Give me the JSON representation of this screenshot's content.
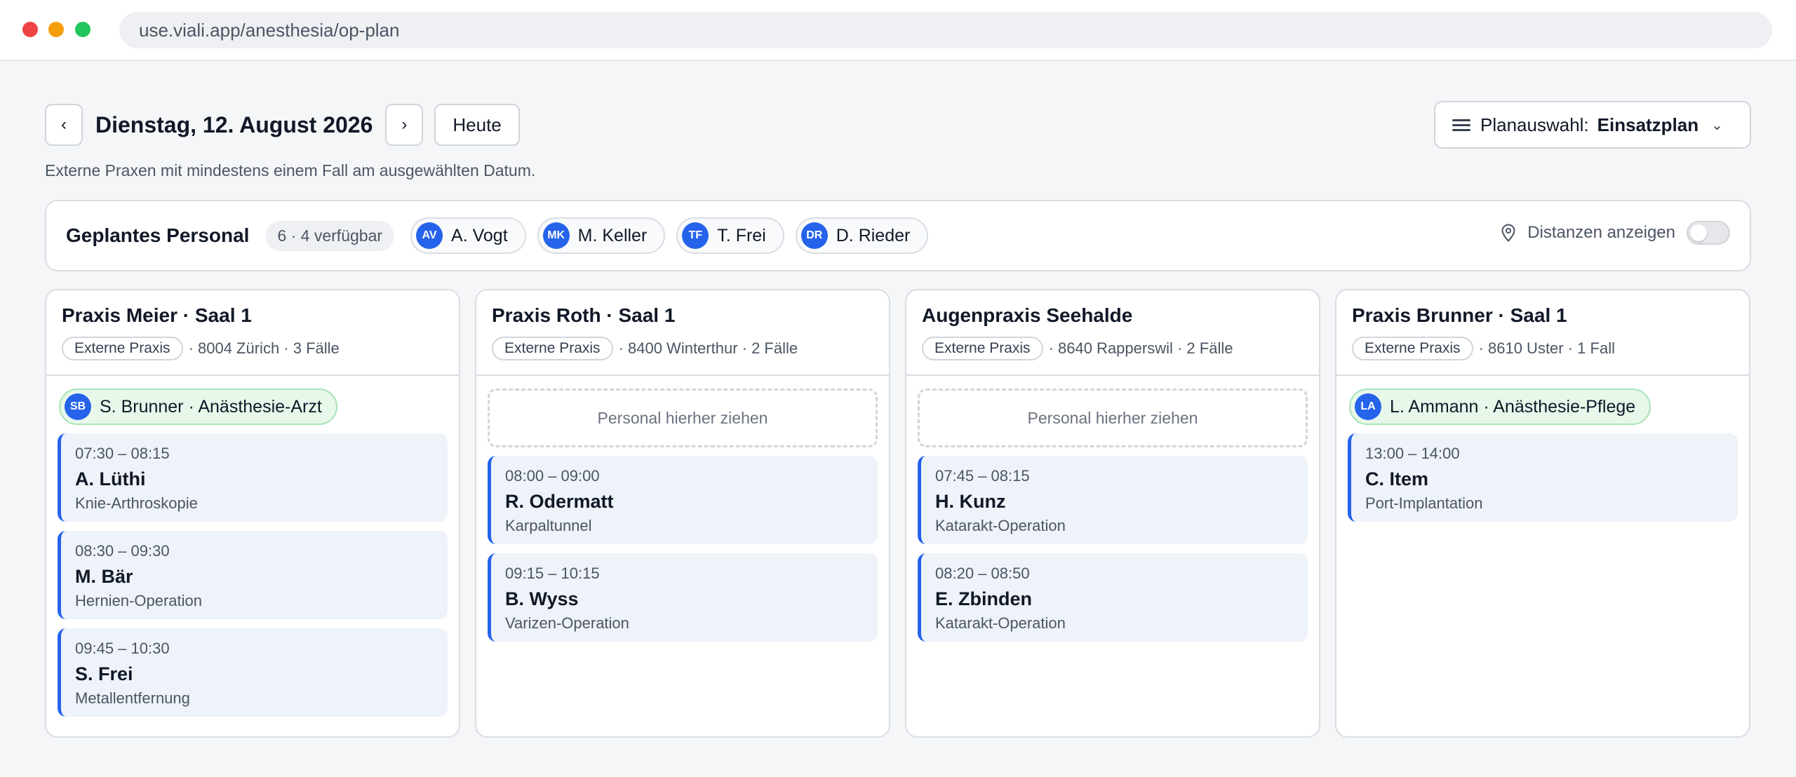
{
  "browser": {
    "url": "use.viali.app/anesthesia/op-plan"
  },
  "toolbar": {
    "prev_label": "‹",
    "next_label": "›",
    "date_title": "Dienstag, 12. August 2026",
    "today_label": "Heute",
    "plan_label": "Planauswahl:",
    "plan_value": "Einsatzplan",
    "plan_chevron": "⌄"
  },
  "subtitle": "Externe Praxen mit mindestens einem Fall am ausgewählten Datum.",
  "staff": {
    "title": "Geplantes Personal",
    "count": "6 · 4 verfügbar",
    "members": [
      {
        "initials": "AV",
        "name": "A. Vogt"
      },
      {
        "initials": "MK",
        "name": "M. Keller"
      },
      {
        "initials": "TF",
        "name": "T. Frei"
      },
      {
        "initials": "DR",
        "name": "D. Rieder"
      }
    ],
    "distance_label": "Distanzen anzeigen",
    "distance_enabled": false
  },
  "columns": [
    {
      "title": "Praxis Meier · Saal 1",
      "badge": "Externe Praxis",
      "meta": "· 8004 Zürich · 3 Fälle",
      "assignee": {
        "initials": "SB",
        "label": "S. Brunner · Anästhesie-Arzt"
      },
      "cases": [
        {
          "time": "07:30 – 08:15",
          "name": "A. Lüthi",
          "procedure": "Knie-Arthroskopie"
        },
        {
          "time": "08:30 – 09:30",
          "name": "M. Bär",
          "procedure": "Hernien-Operation"
        },
        {
          "time": "09:45 – 10:30",
          "name": "S. Frei",
          "procedure": "Metallentfernung"
        }
      ]
    },
    {
      "title": "Praxis Roth · Saal 1",
      "badge": "Externe Praxis",
      "meta": "· 8400 Winterthur · 2 Fälle",
      "dropzone": "Personal hierher ziehen",
      "cases": [
        {
          "time": "08:00 – 09:00",
          "name": "R. Odermatt",
          "procedure": "Karpaltunnel"
        },
        {
          "time": "09:15 – 10:15",
          "name": "B. Wyss",
          "procedure": "Varizen-Operation"
        }
      ]
    },
    {
      "title": "Augenpraxis Seehalde",
      "badge": "Externe Praxis",
      "meta": "· 8640 Rapperswil · 2 Fälle",
      "dropzone": "Personal hierher ziehen",
      "cases": [
        {
          "time": "07:45 – 08:15",
          "name": "H. Kunz",
          "procedure": "Katarakt-Operation"
        },
        {
          "time": "08:20 – 08:50",
          "name": "E. Zbinden",
          "procedure": "Katarakt-Operation"
        }
      ]
    },
    {
      "title": "Praxis Brunner · Saal 1",
      "badge": "Externe Praxis",
      "meta": "· 8610 Uster · 1 Fall",
      "assignee": {
        "initials": "LA",
        "label": "L. Ammann · Anästhesie-Pflege"
      },
      "cases": [
        {
          "time": "13:00 – 14:00",
          "name": "C. Item",
          "procedure": "Port-Implantation"
        }
      ]
    }
  ],
  "colors": {
    "accent": "#2563eb",
    "assignee_bg": "#e7f7ea",
    "case_bg": "#eef2f9"
  }
}
